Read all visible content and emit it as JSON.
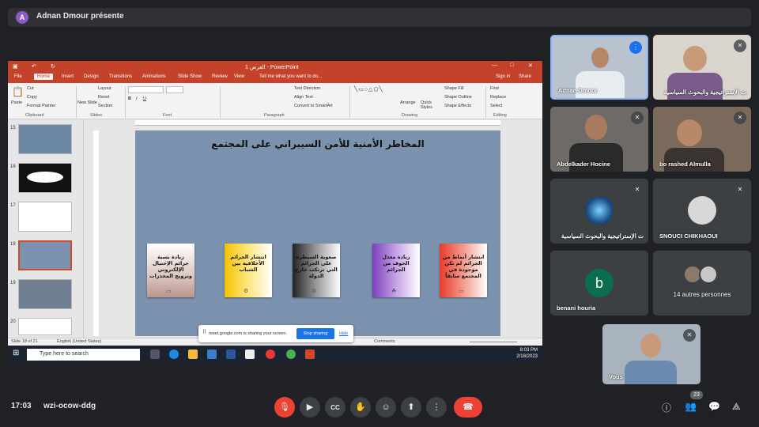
{
  "presenter": {
    "avatar_letter": "A",
    "label": "Adnan Dmour présente"
  },
  "powerpoint": {
    "title": "العرض 1 - PowerPoint",
    "sign_in": "Sign in",
    "share": "Share",
    "tell_me": "Tell me what you want to do...",
    "tabs": [
      "File",
      "Home",
      "Insert",
      "Design",
      "Transitions",
      "Animations",
      "Slide Show",
      "Review",
      "View"
    ],
    "active_tab": "Home",
    "ribbon": {
      "paste": "Paste",
      "cut": "Cut",
      "copy": "Copy",
      "format_painter": "Format Painter",
      "new_slide": "New Slide",
      "layout": "Layout",
      "reset": "Reset",
      "section": "Section",
      "text_direction": "Text Direction",
      "align_text": "Align Text",
      "convert_smartart": "Convert to SmartArt",
      "arrange": "Arrange",
      "quick_styles": "Quick Styles",
      "shape_fill": "Shape Fill",
      "shape_outline": "Shape Outline",
      "shape_effects": "Shape Effects",
      "find": "Find",
      "replace": "Replace",
      "select": "Select",
      "groups": [
        "Clipboard",
        "Slides",
        "Font",
        "Paragraph",
        "Drawing",
        "Editing"
      ]
    },
    "slide_numbers": [
      "15",
      "16",
      "17",
      "18",
      "19",
      "20"
    ],
    "slide": {
      "title": "المخاطر الأمنية للأمن السيبراني على المجتمع",
      "cards": [
        {
          "text": "زيادة نسبة جرائم الإحتيال الإلكتروني وترويج المخدرات",
          "gradient": "linear-gradient(180deg,#fff 0%,#dcc7c2 60%,#b8968c 100%)"
        },
        {
          "text": "انتشار الجرائم الأخلاقية بين الشباب",
          "gradient": "linear-gradient(90deg,#f3c300 0%,#ffe680 50%,#fff 100%)"
        },
        {
          "text": "صعوبة السيطرة على الجرائم التي ترتكب خارج الدولة",
          "gradient": "linear-gradient(90deg,#222 0%,#999 50%,#fff 100%)"
        },
        {
          "text": "زيادة معدل الخوف من الجرائم",
          "gradient": "linear-gradient(90deg,#7b3fb8 0%,#c6a3e6 50%,#fff 100%)"
        },
        {
          "text": "انتشار أنماط من الجرائم لم تكن موجودة في المجتمع سابقاً",
          "gradient": "linear-gradient(90deg,#e83c2a 0%,#f59a8c 50%,#fff 100%)"
        }
      ]
    },
    "status": {
      "slide_of": "Slide 18 of 21",
      "language": "English (United States)",
      "notes": "Notes",
      "comments": "Comments"
    }
  },
  "taskbar": {
    "search_placeholder": "Type here to search",
    "time": "8:03 PM",
    "date": "2/18/2023"
  },
  "share_popup": {
    "message": "meet.google.com is sharing your screen.",
    "stop": "Stop sharing",
    "hide": "Hide"
  },
  "participants": [
    {
      "name": "Adnan Dmour"
    },
    {
      "name": "ت الإستراتيجية والبحوث السياسية"
    },
    {
      "name": "Abdelkader Hocine"
    },
    {
      "name": "bo rashed Almulla"
    },
    {
      "name": "ت الإستراتيجية والبحوث السياسية"
    },
    {
      "name": "SNOUCI CHIKHAOUI"
    },
    {
      "name": "benani houria",
      "avatar_letter": "b"
    },
    {
      "name": "14 autres personnes"
    },
    {
      "name": "Vous"
    }
  ],
  "meeting": {
    "time": "17:03",
    "code": "wzi-ocow-ddg",
    "people_count": "23"
  }
}
